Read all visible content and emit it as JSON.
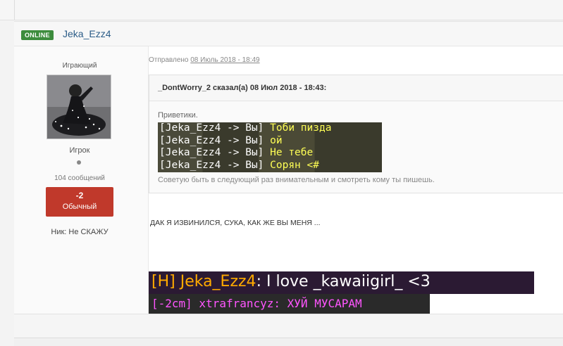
{
  "post": {
    "online_badge": "ONLINE",
    "author": "Jeka_Ezz4",
    "user_title": "Играющий",
    "avatar_icon": "avatar-figure-icon",
    "group": "Игрок",
    "posts_count": "104 сообщений",
    "reputation": {
      "value": "-2",
      "label": "Обычный",
      "color": "#c0392b"
    },
    "nick_label": "Ник:",
    "nick_value": "Не СКАЖУ",
    "posted_prefix": "Отправлено",
    "posted_date": "08 Июль 2018 - 18:49",
    "quote": {
      "header": "_DontWorry_2 сказал(а) 08 Июл 2018 - 18:43:",
      "greeting": "Приветики.",
      "chat_lines": [
        {
          "prefix": "[Jeka_Ezz4 -> Вы]",
          "message": "Тоби пизда"
        },
        {
          "prefix": "[Jeka_Ezz4 -> Вы]",
          "message": "ой"
        },
        {
          "prefix": "[Jeka_Ezz4 -> Вы]",
          "message": "Не тебе"
        },
        {
          "prefix": "[Jeka_Ezz4 -> Вы]",
          "message": "Сорян <#"
        }
      ],
      "footer": "Советую быть в следующий раз внимательным и смотреть кому ты пишешь."
    },
    "reply_text": "ДАК Я ИЗВИНИЛСЯ, СУКА, КАК ЖЕ ВЫ МЕНЯ ...",
    "screenshot2": {
      "prefix": "[H] Jeka_Ezz4",
      "message": "I love _kawaiigirl_ <3"
    },
    "screenshot3": {
      "text": "[-2cm] xtrafrancyz: ХУЙ МУСАРАМ"
    }
  },
  "colors": {
    "online": "#3d8c3d",
    "author_link": "#2c5d88",
    "mc_yellow": "#ffff55",
    "mc_gold": "#ffaa00",
    "mc_pink": "#ff55ff"
  }
}
